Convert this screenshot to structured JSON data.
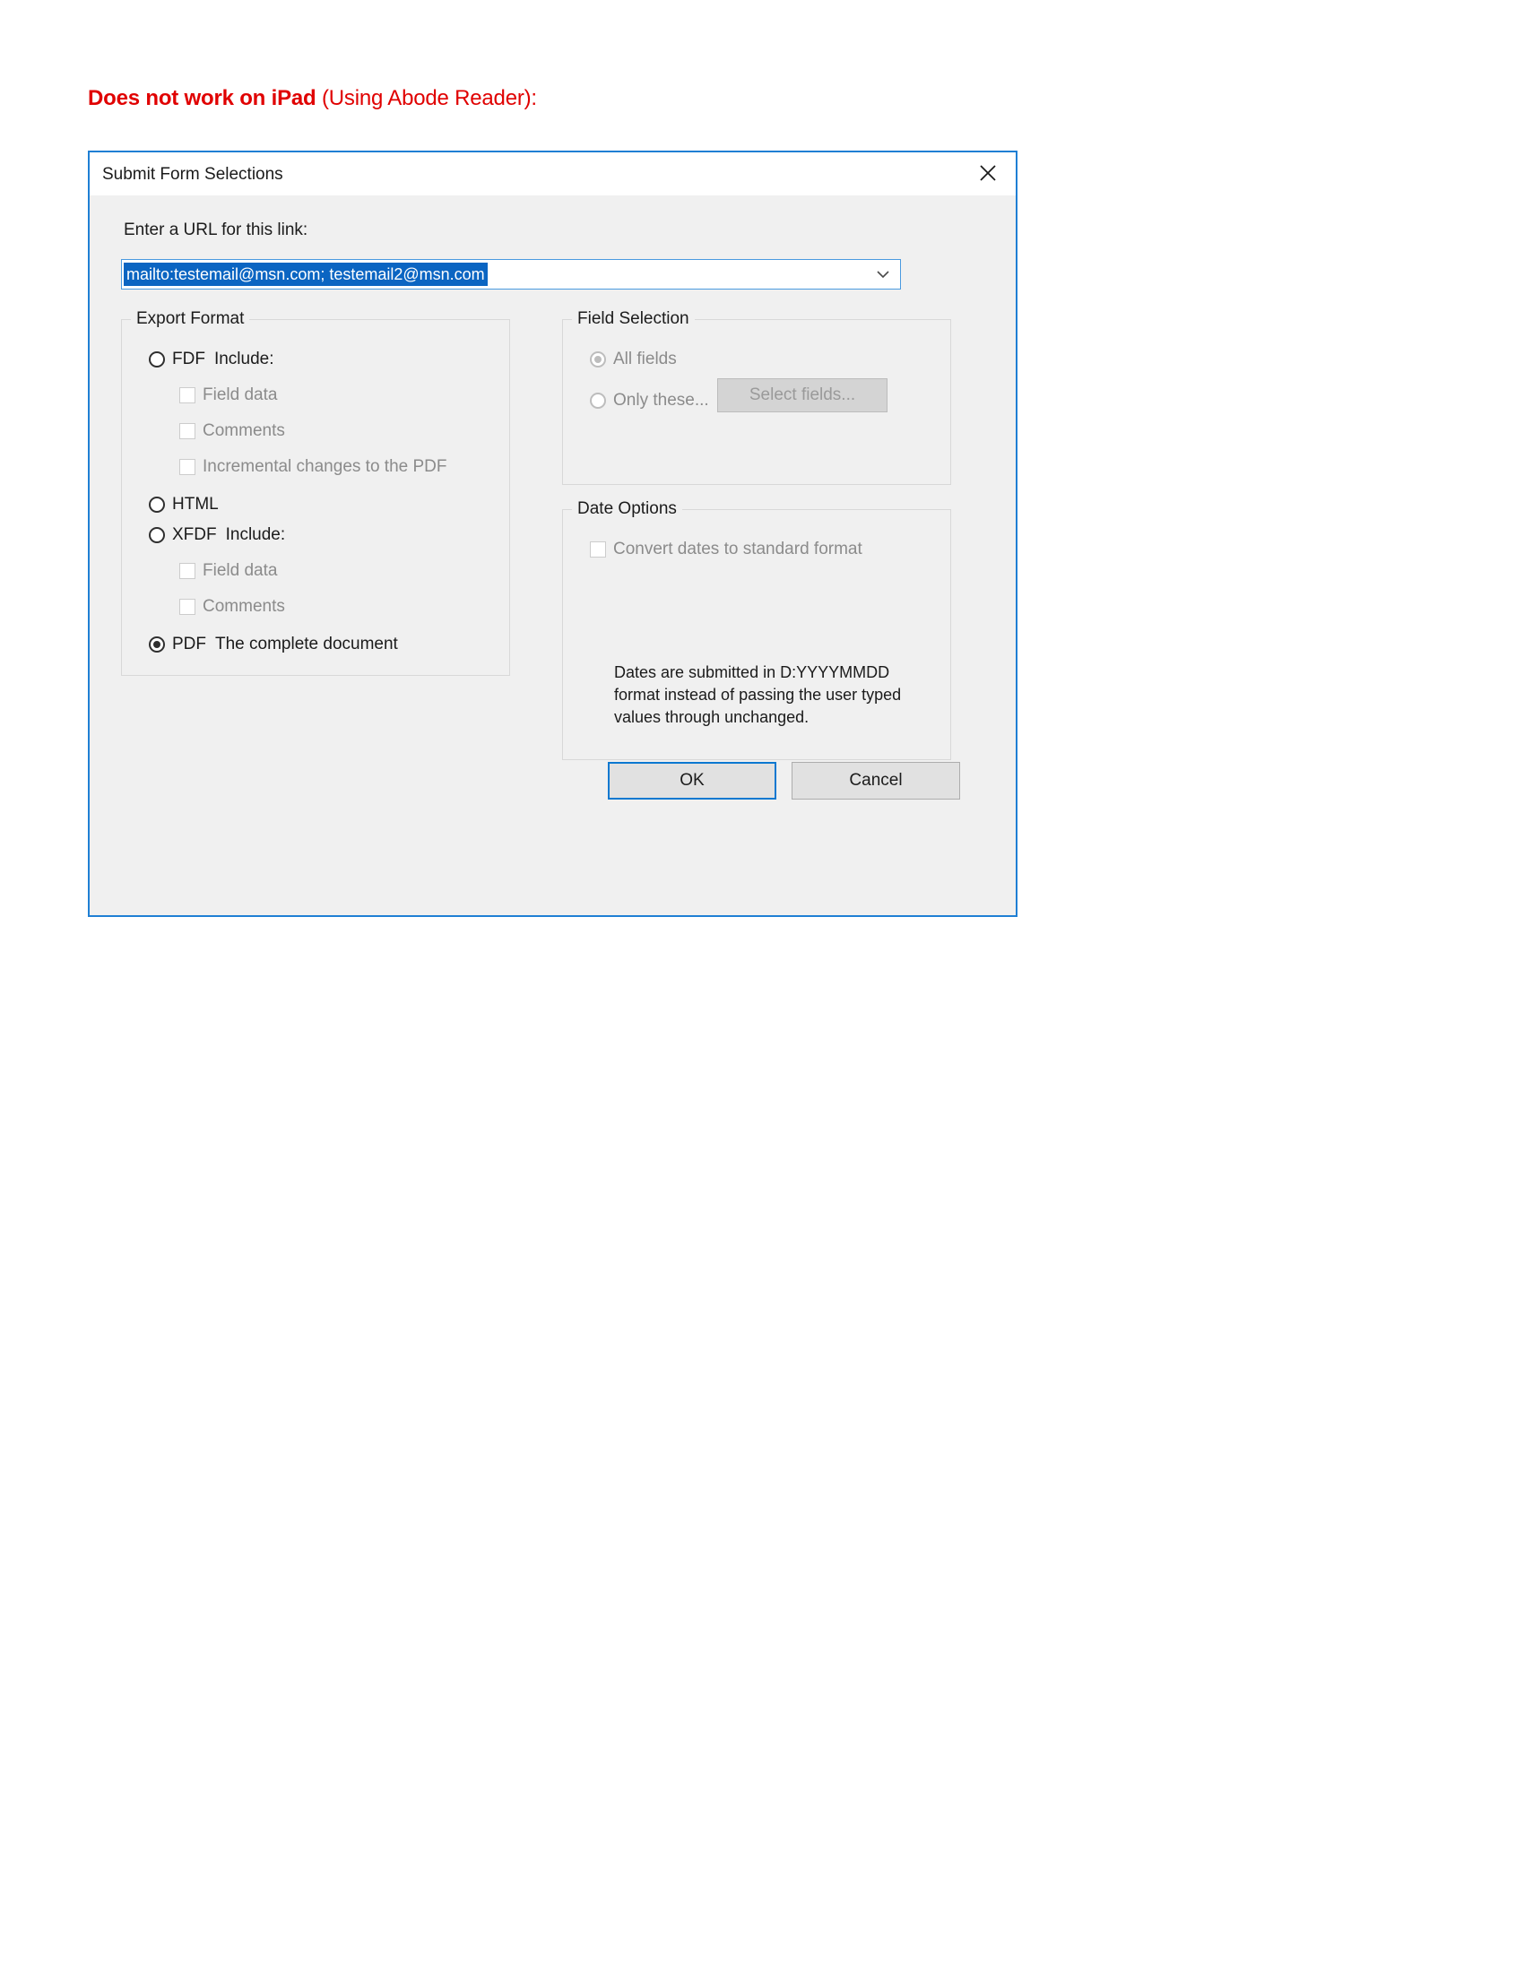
{
  "page": {
    "heading_bold": "Does not work on iPad",
    "heading_rest": " (Using Abode Reader):",
    "heading_color": "#e00000"
  },
  "dialog": {
    "title": "Submit Form Selections",
    "close_icon": "close-icon",
    "accent_color": "#1f7fd4",
    "url": {
      "label": "Enter a URL for this link:",
      "value": "mailto:testemail@msn.com; testemail2@msn.com",
      "placeholder": "",
      "dropdown_icon": "chevron-down-icon",
      "selection_color": "#0b65c2"
    },
    "export_format": {
      "legend": "Export Format",
      "options": [
        {
          "id": "fdf",
          "label": "FDF",
          "suffix": "Include:",
          "selected": false
        },
        {
          "id": "html",
          "label": "HTML",
          "suffix": "",
          "selected": false
        },
        {
          "id": "xfdf",
          "label": "XFDF",
          "suffix": "Include:",
          "selected": false
        },
        {
          "id": "pdf",
          "label": "PDF",
          "suffix": "The complete document",
          "selected": true
        }
      ],
      "fdf_includes": [
        {
          "label": "Field data",
          "checked": false,
          "disabled": true
        },
        {
          "label": "Comments",
          "checked": false,
          "disabled": true
        },
        {
          "label": "Incremental changes to the PDF",
          "checked": false,
          "disabled": true
        }
      ],
      "xfdf_includes": [
        {
          "label": "Field data",
          "checked": false,
          "disabled": true
        },
        {
          "label": "Comments",
          "checked": false,
          "disabled": true
        }
      ]
    },
    "field_selection": {
      "legend": "Field Selection",
      "all_fields_label": "All fields",
      "all_fields_selected": true,
      "only_these_label": "Only these...",
      "only_these_selected": false,
      "select_fields_button": "Select fields...",
      "disabled": true
    },
    "date_options": {
      "legend": "Date Options",
      "convert_label": "Convert dates to standard format",
      "convert_checked": false,
      "convert_disabled": true,
      "note": "Dates are submitted in D:YYYYMMDD format instead of passing the user typed values through unchanged."
    },
    "footer": {
      "ok_label": "OK",
      "cancel_label": "Cancel"
    }
  }
}
